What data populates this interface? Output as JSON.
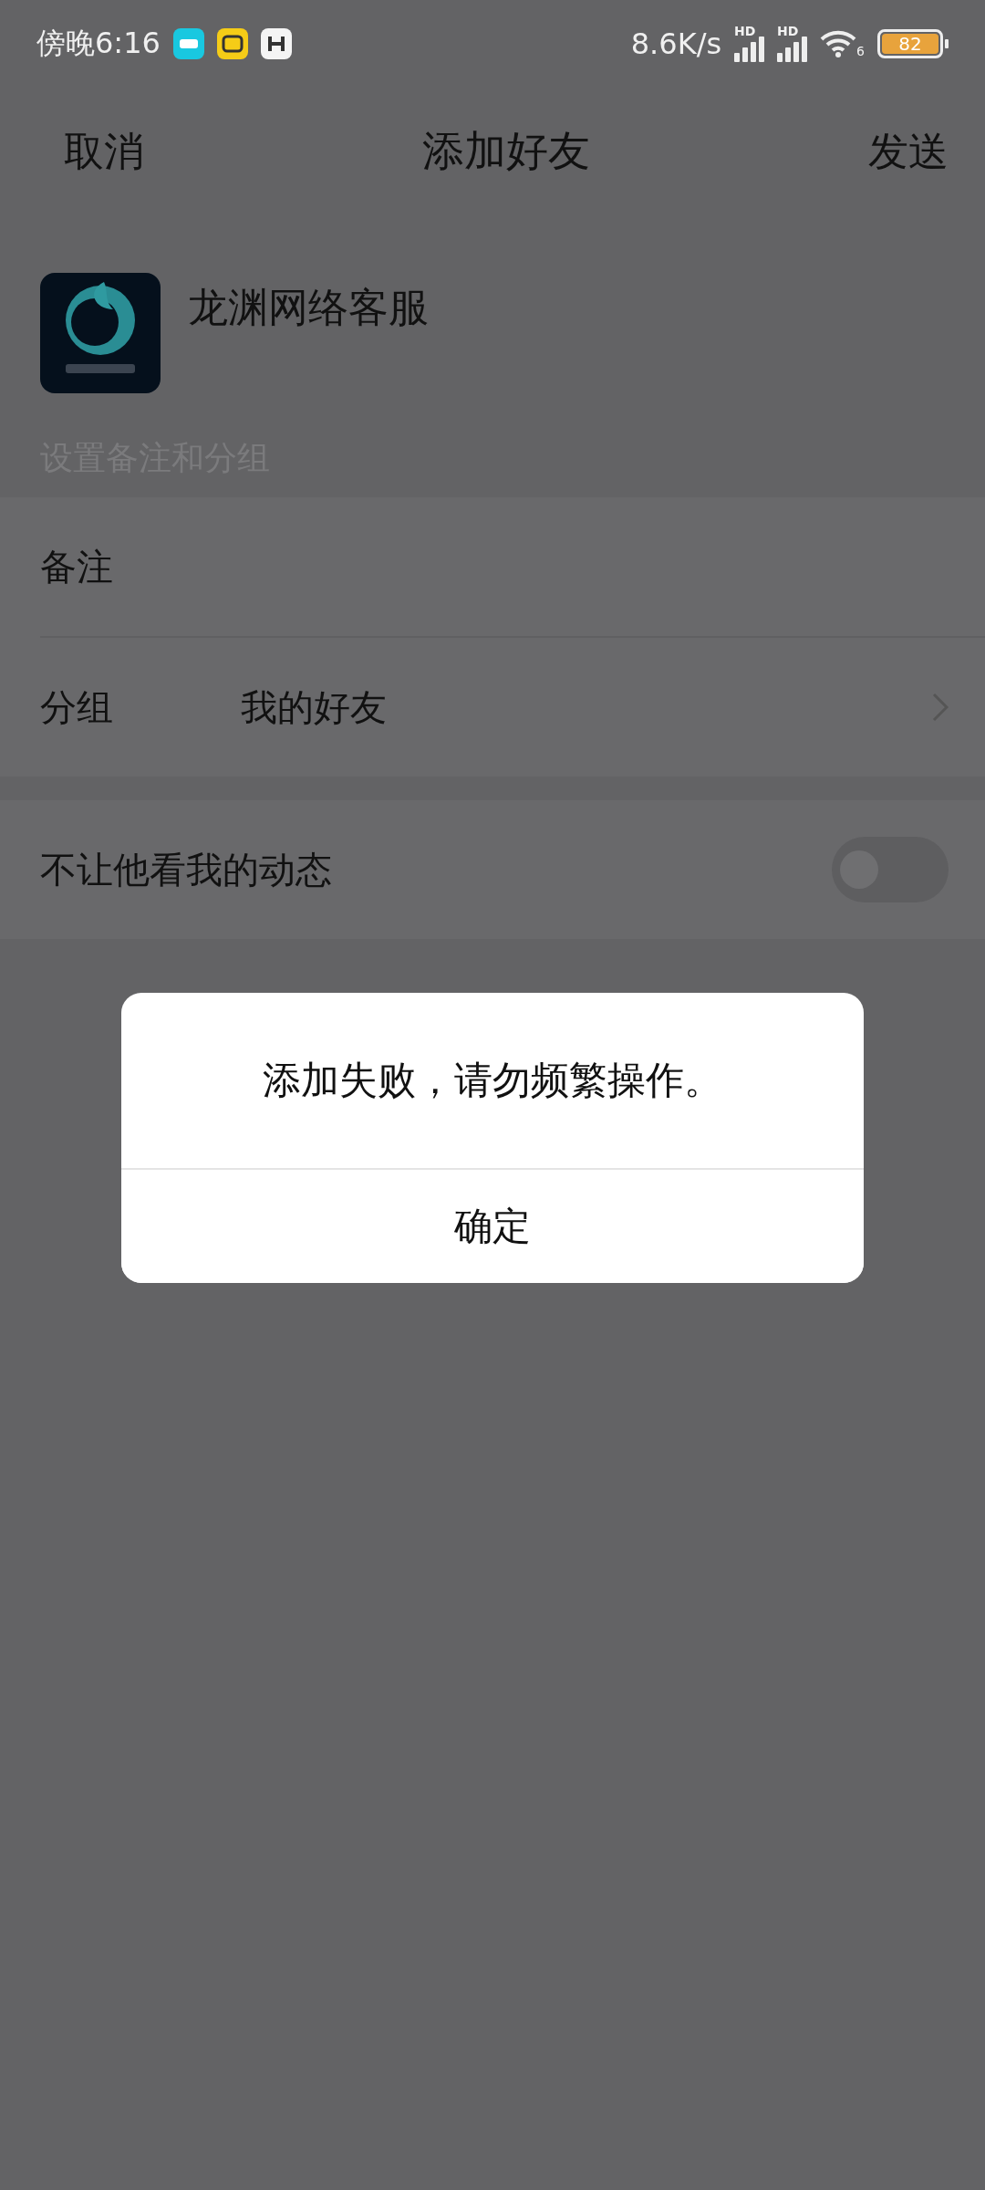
{
  "status_bar": {
    "time": "傍晚6:16",
    "net_speed": "8.6K/s",
    "signal_labels": [
      "HD",
      "HD"
    ],
    "wifi_label": "6",
    "battery": "82"
  },
  "header": {
    "cancel": "取消",
    "title": "添加好友",
    "send": "发送"
  },
  "contact": {
    "name": "龙渊网络客服"
  },
  "section_label": "设置备注和分组",
  "fields": [
    {
      "kind": "input",
      "label": "备注"
    },
    {
      "kind": "select",
      "label": "分组",
      "value": "我的好友"
    }
  ],
  "privacy": {
    "label": "不让他看我的动态",
    "on": false
  },
  "dialog": {
    "message": "添加失败，请勿频繁操作。",
    "button": "确定"
  }
}
